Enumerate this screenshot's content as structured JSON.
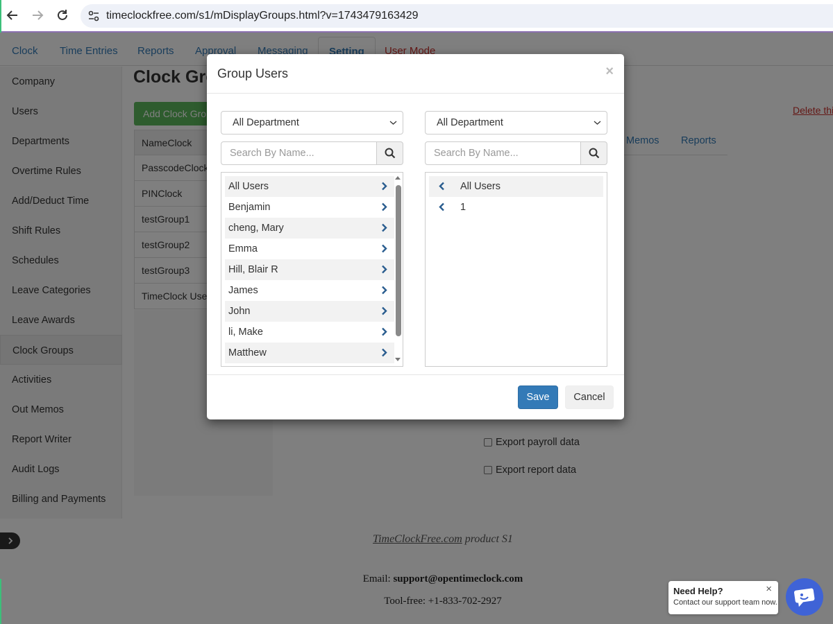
{
  "browser": {
    "url": "timeclockfree.com/s1/mDisplayGroups.html?v=1743479163429"
  },
  "top_nav": {
    "tabs": [
      {
        "label": "Clock"
      },
      {
        "label": "Time Entries"
      },
      {
        "label": "Reports"
      },
      {
        "label": "Approval"
      },
      {
        "label": "Messaging"
      },
      {
        "label": "Setting"
      },
      {
        "label": "User Mode"
      }
    ]
  },
  "sidebar": {
    "items": [
      {
        "label": "Company"
      },
      {
        "label": "Users"
      },
      {
        "label": "Departments"
      },
      {
        "label": "Overtime Rules"
      },
      {
        "label": "Add/Deduct Time"
      },
      {
        "label": "Shift Rules"
      },
      {
        "label": "Schedules"
      },
      {
        "label": "Leave Categories"
      },
      {
        "label": "Leave Awards"
      },
      {
        "label": "Clock Groups"
      },
      {
        "label": "Activities"
      },
      {
        "label": "Out Memos"
      },
      {
        "label": "Report Writer"
      },
      {
        "label": "Audit Logs"
      },
      {
        "label": "Billing and Payments"
      }
    ]
  },
  "content": {
    "title": "Clock Gro",
    "add_button": "Add Clock Gro",
    "group_header": "NameClock",
    "groups": [
      "PasscodeClock",
      "PINClock",
      "testGroup1",
      "testGroup2",
      "testGroup3",
      "TimeClock Use"
    ],
    "delete_link": "Delete thi",
    "subtabs": [
      "Memos",
      "Reports"
    ],
    "permissions": [
      {
        "label": "Export payroll data",
        "checked": false
      },
      {
        "label": "Export report data",
        "checked": false
      }
    ]
  },
  "footer": {
    "product_link": "TimeClockFree.com",
    "product_suffix": " product S1",
    "email_label": "Email: ",
    "email": "support@opentimeclock.com",
    "phone": "Tool-free: +1-833-702-2927"
  },
  "modal": {
    "title": "Group Users",
    "close": "×",
    "left": {
      "department": "All Department",
      "search_placeholder": "Search By Name...",
      "users": [
        "All Users",
        "Benjamin",
        "cheng, Mary",
        "Emma",
        "Hill, Blair R",
        "James",
        "John",
        "li, Make",
        "Matthew"
      ]
    },
    "right": {
      "department": "All Department",
      "search_placeholder": "Search By Name...",
      "users": [
        "All Users",
        "1"
      ]
    },
    "save": "Save",
    "cancel": "Cancel"
  },
  "help": {
    "title": "Need Help?",
    "subtitle": "Contact our support team now.",
    "close": "×"
  },
  "colors": {
    "primary": "#337ab7",
    "success": "#5cb85c",
    "danger": "#c9302c",
    "chat": "#3f63d6"
  }
}
